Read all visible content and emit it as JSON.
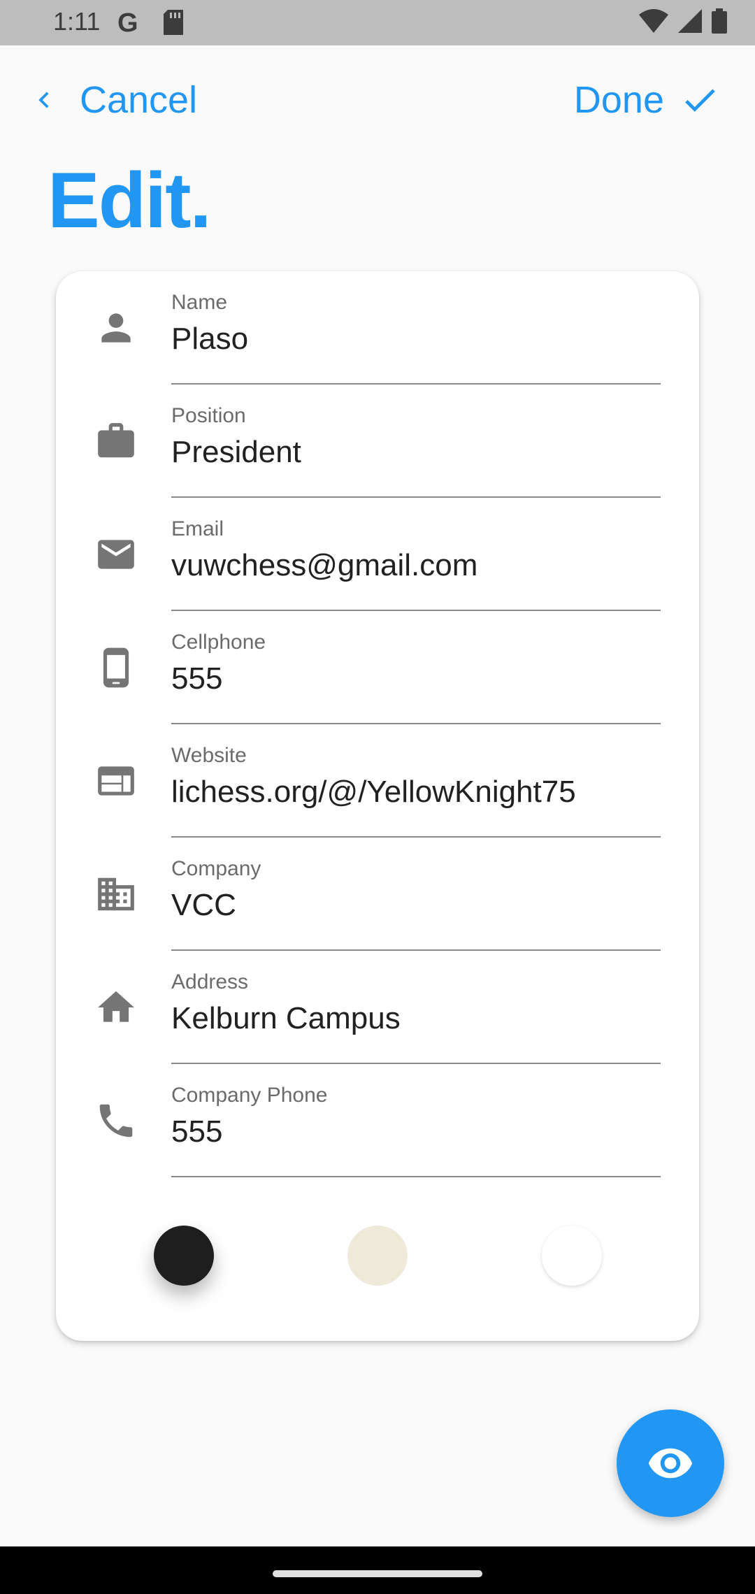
{
  "status_bar": {
    "time": "1:11",
    "left_icons": [
      "google-icon",
      "sd-card-icon"
    ],
    "right_icons": [
      "wifi-icon",
      "signal-icon",
      "battery-icon"
    ]
  },
  "header": {
    "cancel_label": "Cancel",
    "done_label": "Done",
    "title": "Edit."
  },
  "fields": [
    {
      "label": "Name",
      "value": "Plaso",
      "icon": "person-icon"
    },
    {
      "label": "Position",
      "value": "President",
      "icon": "briefcase-icon"
    },
    {
      "label": "Email",
      "value": "vuwchess@gmail.com",
      "icon": "email-icon"
    },
    {
      "label": "Cellphone",
      "value": "555",
      "icon": "smartphone-icon"
    },
    {
      "label": "Website",
      "value": "lichess.org/@/YellowKnight75",
      "icon": "web-icon"
    },
    {
      "label": "Company",
      "value": "VCC",
      "icon": "building-icon"
    },
    {
      "label": "Address",
      "value": "Kelburn Campus",
      "icon": "home-icon"
    },
    {
      "label": "Company Phone",
      "value": "555",
      "icon": "phone-icon"
    }
  ],
  "color_swatches": [
    {
      "name": "black",
      "color": "#1e1e1e",
      "selected": true
    },
    {
      "name": "cream",
      "color": "#efe9da",
      "selected": false
    },
    {
      "name": "white",
      "color": "#ffffff",
      "selected": false
    }
  ],
  "fab_icon": "eye-icon",
  "colors": {
    "accent": "#2196f3",
    "icon_gray": "#757575"
  }
}
